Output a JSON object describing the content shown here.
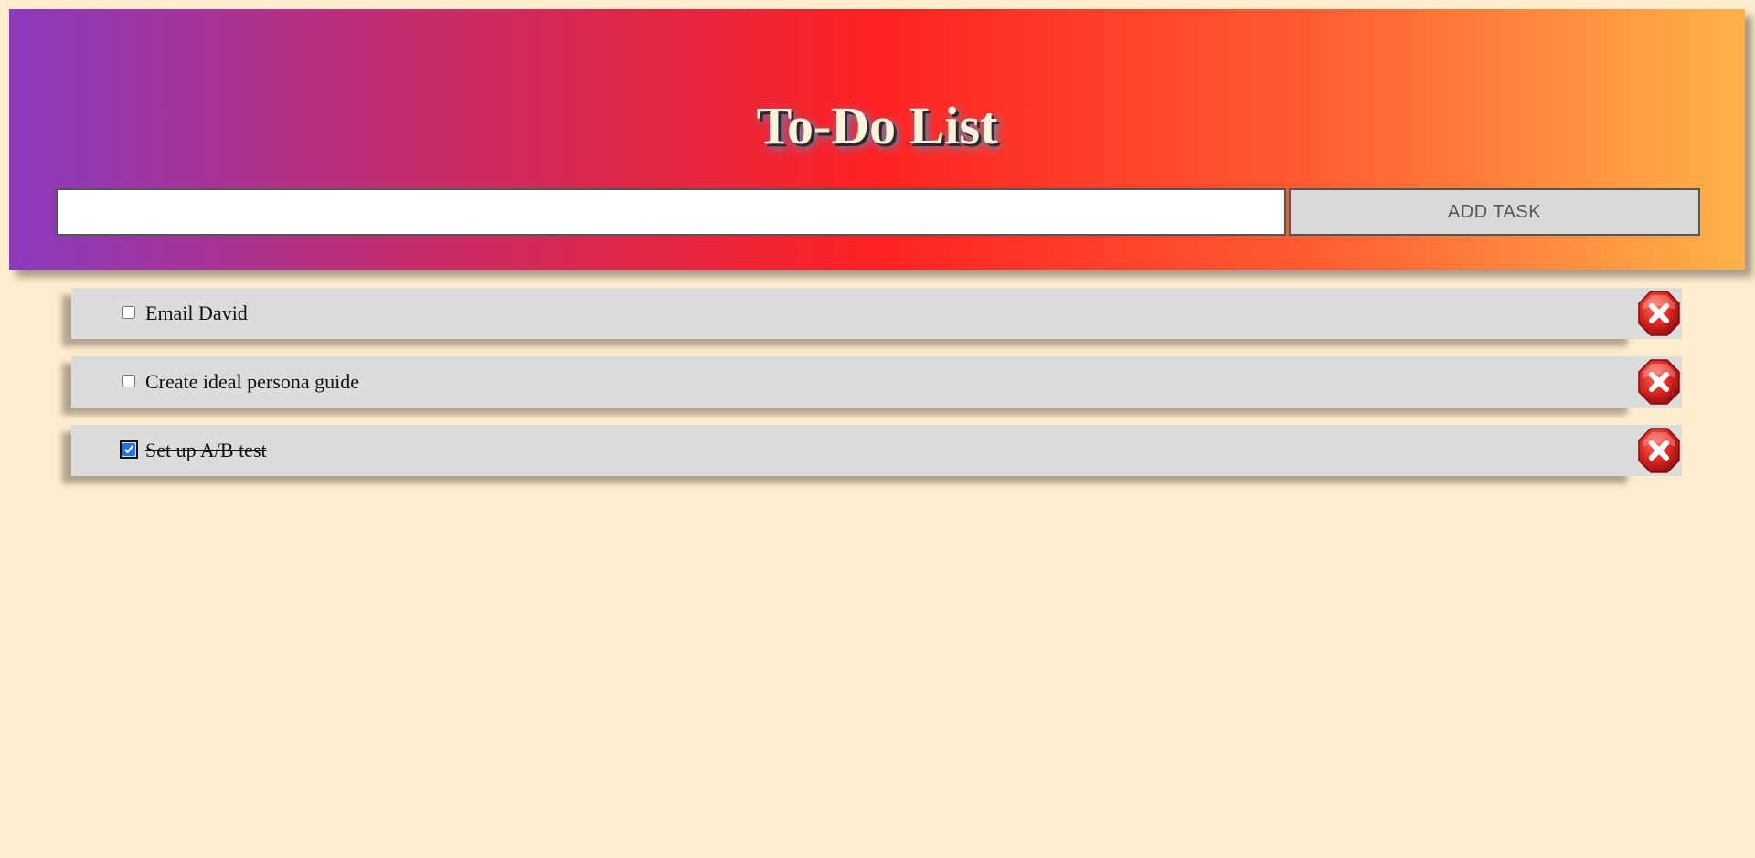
{
  "header": {
    "title": "To-Do List",
    "input_value": "",
    "add_button_label": "ADD TASK"
  },
  "tasks": [
    {
      "text": "Email David",
      "completed": false
    },
    {
      "text": "Create ideal persona guide",
      "completed": false
    },
    {
      "text": "Set up A/B test",
      "completed": true
    }
  ],
  "icons": {
    "delete": "close-x-icon"
  },
  "colors": {
    "background": "#ffebcd",
    "gradient": [
      "#8a3bbf",
      "#c82b66",
      "#fe2222",
      "#ff5c32",
      "#ffb24a"
    ],
    "item_background": "#dcdcdc",
    "delete_red": "#d21f1f"
  }
}
